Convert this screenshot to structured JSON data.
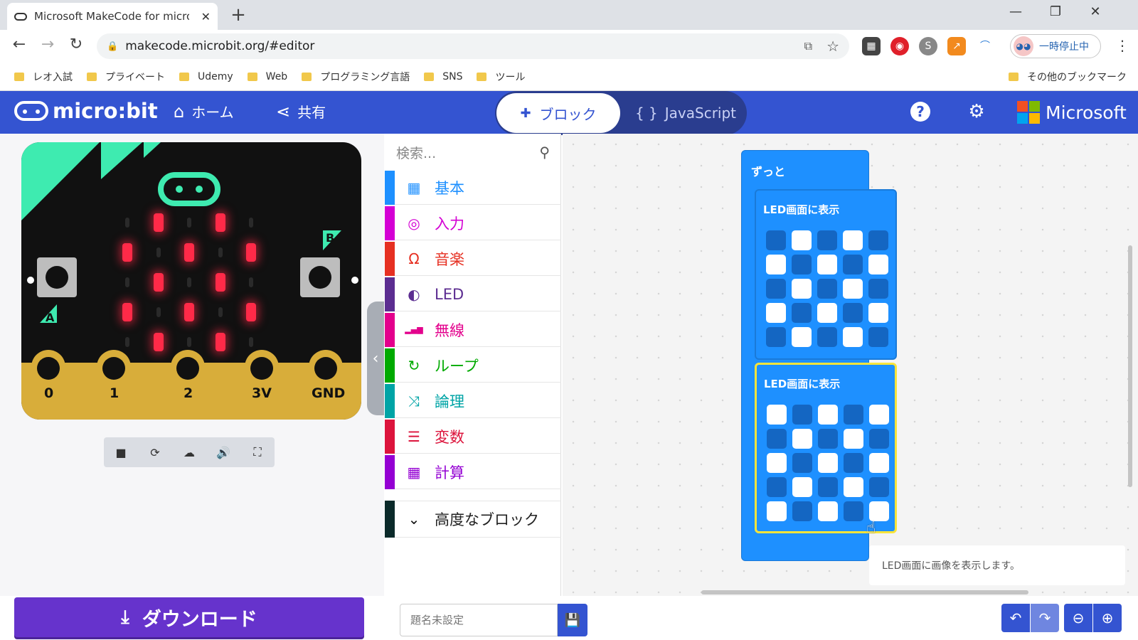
{
  "browser": {
    "tab_title": "Microsoft MakeCode for micro:bit",
    "url": "makecode.microbit.org/#editor",
    "profile_label": "一時停止中",
    "bookmarks": [
      "レオ入試",
      "プライベート",
      "Udemy",
      "Web",
      "プログラミング言語",
      "SNS",
      "ツール"
    ],
    "other_bookmarks": "その他のブックマーク"
  },
  "header": {
    "logo": "micro:bit",
    "home": "ホーム",
    "share": "共有",
    "mode_blocks": "ブロック",
    "mode_js": "JavaScript",
    "brand": "Microsoft"
  },
  "simulator": {
    "pins": [
      "0",
      "1",
      "2",
      "3V",
      "GND"
    ],
    "button_a": "A",
    "button_b": "B",
    "led_matrix": [
      [
        0,
        1,
        0,
        1,
        0
      ],
      [
        1,
        0,
        1,
        0,
        1
      ],
      [
        0,
        1,
        0,
        1,
        0
      ],
      [
        1,
        0,
        1,
        0,
        1
      ],
      [
        0,
        1,
        0,
        1,
        0
      ]
    ]
  },
  "toolbox": {
    "search_placeholder": "検索...",
    "categories": [
      {
        "label": "基本",
        "color": "#1e90ff",
        "icon": "grid-icon"
      },
      {
        "label": "入力",
        "color": "#d400d4",
        "icon": "target-icon"
      },
      {
        "label": "音楽",
        "color": "#e63022",
        "icon": "headphones-icon"
      },
      {
        "label": "LED",
        "color": "#5c2d91",
        "icon": "toggle-icon"
      },
      {
        "label": "無線",
        "color": "#e3008c",
        "icon": "signal-icon"
      },
      {
        "label": "ループ",
        "color": "#00aa00",
        "icon": "loop-icon"
      },
      {
        "label": "論理",
        "color": "#00a4a6",
        "icon": "shuffle-icon"
      },
      {
        "label": "変数",
        "color": "#dc143c",
        "icon": "lines-icon"
      },
      {
        "label": "計算",
        "color": "#9400d3",
        "icon": "calculator-icon"
      }
    ],
    "advanced": "高度なブロック"
  },
  "workspace": {
    "forever_label": "ずっと",
    "show_leds_label": "LED画面に表示",
    "show_leds_1": [
      [
        0,
        1,
        0,
        1,
        0
      ],
      [
        1,
        0,
        1,
        0,
        1
      ],
      [
        0,
        1,
        0,
        1,
        0
      ],
      [
        1,
        0,
        1,
        0,
        1
      ],
      [
        0,
        1,
        0,
        1,
        0
      ]
    ],
    "show_leds_2": [
      [
        1,
        0,
        1,
        0,
        1
      ],
      [
        0,
        1,
        0,
        1,
        0
      ],
      [
        1,
        0,
        1,
        0,
        1
      ],
      [
        0,
        1,
        0,
        1,
        0
      ],
      [
        1,
        0,
        1,
        0,
        1
      ]
    ],
    "tooltip": "LED画面に画像を表示します。"
  },
  "footer": {
    "download": "ダウンロード",
    "project_placeholder": "題名未設定"
  }
}
